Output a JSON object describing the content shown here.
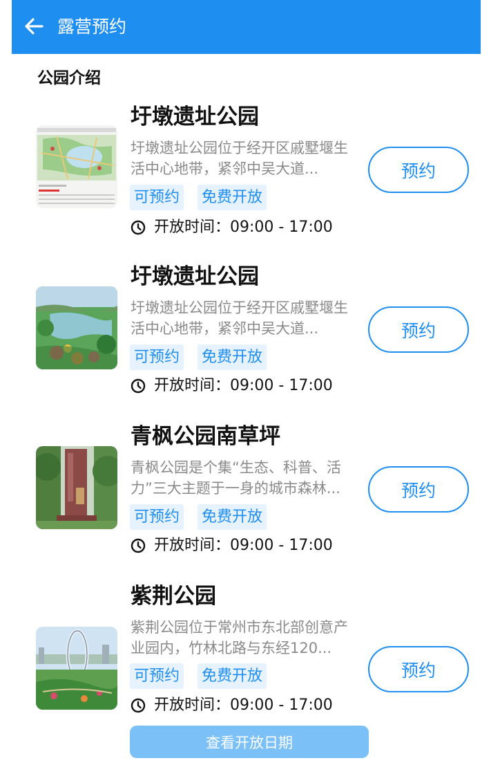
{
  "header": {
    "title": "露营预约",
    "back_icon": "arrow-left-icon",
    "background": "#1f8ef1"
  },
  "section": {
    "title": "公园介绍"
  },
  "parks": [
    {
      "name": "圩墩遗址公园",
      "description": "圩墩遗址公园位于经开区戚墅堰生活中心地带，紧邻中吴大道...",
      "tags": [
        "可预约",
        "免费开放"
      ],
      "hours_label": "开放时间：",
      "hours": "09:00 - 17:00",
      "button": "预约"
    },
    {
      "name": "圩墩遗址公园",
      "description": "圩墩遗址公园位于经开区戚墅堰生活中心地带，紧邻中吴大道...",
      "tags": [
        "可预约",
        "免费开放"
      ],
      "hours_label": "开放时间：",
      "hours": "09:00 - 17:00",
      "button": "预约"
    },
    {
      "name": "青枫公园南草坪",
      "description": "青枫公园是个集“生态、科普、活力”三大主题于一身的城市森林...",
      "tags": [
        "可预约",
        "免费开放"
      ],
      "hours_label": "开放时间：",
      "hours": "09:00 - 17:00",
      "button": "预约"
    },
    {
      "name": "紫荆公园",
      "description": "紫荆公园位于常州市东北部创意产业园内，竹林北路与东经120...",
      "tags": [
        "可预约",
        "免费开放"
      ],
      "hours_label": "开放时间：",
      "hours": "09:00 - 17:00",
      "button": "预约"
    }
  ],
  "footer": {
    "view_dates": "查看开放日期"
  },
  "colors": {
    "accent": "#1f8ef1",
    "tag_bg": "#e6f2fd",
    "muted_text": "#8a8a8a",
    "footer_button": "#7cc0f8"
  }
}
